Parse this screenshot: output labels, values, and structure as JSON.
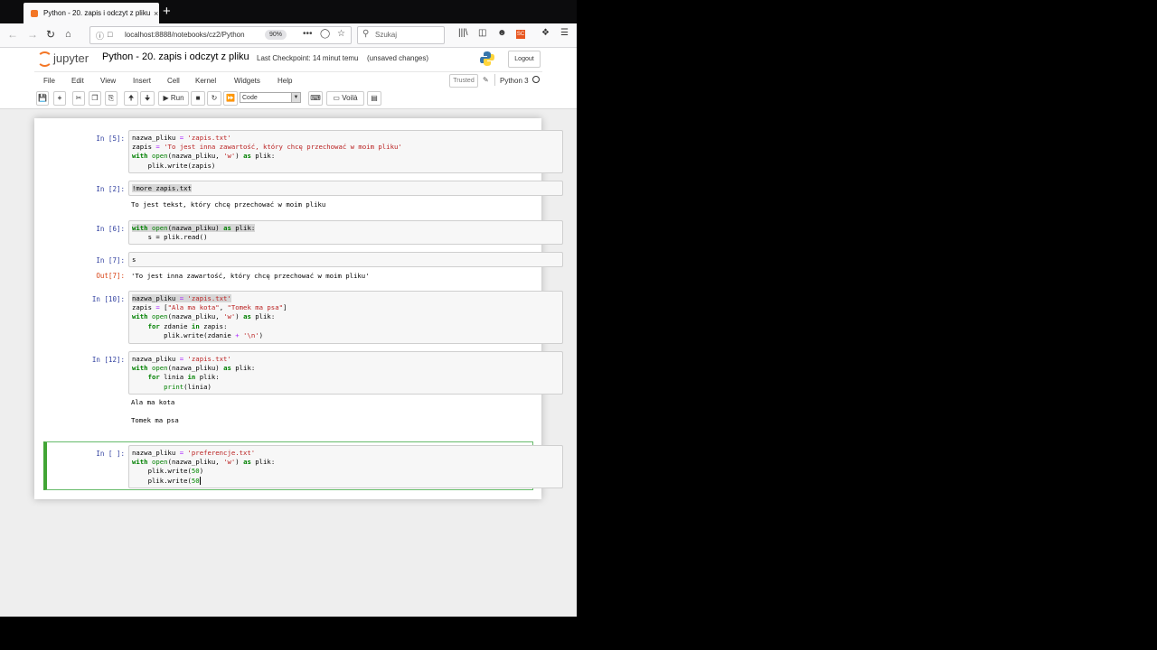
{
  "browser": {
    "tab_title": "Python - 20. zapis i odczyt z pliku",
    "tab_close": "×",
    "new_tab": "+",
    "url": "localhost:8888/notebooks/cz2/Python",
    "zoom": "90%",
    "search_placeholder": "Szukaj",
    "page_actions": "•••"
  },
  "jupyter": {
    "logo_text": "jupyter",
    "notebook_title": "Python - 20. zapis i odczyt z pliku",
    "checkpoint": "Last Checkpoint: 14 minut temu",
    "unsaved": "(unsaved changes)",
    "logout": "Logout",
    "menu": [
      "File",
      "Edit",
      "View",
      "Insert",
      "Cell",
      "Kernel",
      "Widgets",
      "Help"
    ],
    "trusted": "Trusted",
    "kernel_name": "Python 3",
    "toolbar": {
      "run": "Run",
      "cell_type": "Code",
      "voila": "Voilà"
    }
  },
  "cells": {
    "c1": {
      "prompt": "In [5]:"
    },
    "c2": {
      "prompt": "In [2]:",
      "output": "To jest tekst, który chcę przechować w moim pliku"
    },
    "c3": {
      "prompt": "In [6]:"
    },
    "c4": {
      "prompt": "In [7]:",
      "out_prompt": "Out[7]:",
      "output": "'To jest inna zawartość, który chcę przechować w moim pliku'"
    },
    "c5": {
      "prompt": "In [10]:"
    },
    "c6": {
      "prompt": "In [12]:",
      "output1": "Ala ma kota",
      "output2": "Tomek ma psa"
    },
    "c7": {
      "prompt": "In [ ]:"
    }
  },
  "code": {
    "c1_l1_a": "nazwa_pliku ",
    "c1_l1_b": "=",
    "c1_l1_c": " 'zapis.txt'",
    "c1_l2_a": "zapis ",
    "c1_l2_b": "=",
    "c1_l2_c": " 'To jest inna zawartość, który chcę przechować w moim pliku'",
    "c1_l3_kw": "with",
    "c1_l3_fn": "open",
    "c1_l3_a": "(nazwa_pliku, ",
    "c1_l3_s": "'w'",
    "c1_l3_b": ") ",
    "c1_l3_as": "as",
    "c1_l3_c": " plik:",
    "c1_l4": "    plik.write(zapis)",
    "c2_l1": "!more zapis.txt",
    "c3_l1_kw": "with",
    "c3_l1_fn": "open",
    "c3_l1_a": "(nazwa_pliku) ",
    "c3_l1_as": "as",
    "c3_l1_b": " plik:",
    "c3_l2": "    s = plik.read()",
    "c4_l1": "s",
    "c5_l1_a": "nazwa_pliku ",
    "c5_l1_b": "=",
    "c5_l1_c": " 'zapis.txt'",
    "c5_l2_a": "zapis ",
    "c5_l2_b": "=",
    "c5_l2_c": " [",
    "c5_l2_s1": "\"Ala ma kota\"",
    "c5_l2_d": ", ",
    "c5_l2_s2": "\"Tomek ma psa\"",
    "c5_l2_e": "]",
    "c5_l3_kw": "with",
    "c5_l3_fn": "open",
    "c5_l3_a": "(nazwa_pliku, ",
    "c5_l3_s": "'w'",
    "c5_l3_b": ") ",
    "c5_l3_as": "as",
    "c5_l3_c": " plik:",
    "c5_l4_ind": "    ",
    "c5_l4_kw": "for",
    "c5_l4_a": " zdanie ",
    "c5_l4_in": "in",
    "c5_l4_b": " zapis:",
    "c5_l5_a": "        plik.write(zdanie ",
    "c5_l5_op": "+",
    "c5_l5_s": " '\\n'",
    "c5_l5_b": ")",
    "c6_l1_a": "nazwa_pliku ",
    "c6_l1_b": "=",
    "c6_l1_c": " 'zapis.txt'",
    "c6_l2_kw": "with",
    "c6_l2_fn": "open",
    "c6_l2_a": "(nazwa_pliku) ",
    "c6_l2_as": "as",
    "c6_l2_b": " plik:",
    "c6_l3_ind": "    ",
    "c6_l3_kw": "for",
    "c6_l3_a": " linia ",
    "c6_l3_in": "in",
    "c6_l3_b": " plik:",
    "c6_l4_ind": "        ",
    "c6_l4_fn": "print",
    "c6_l4_a": "(linia)",
    "c7_l1_a": "nazwa_pliku ",
    "c7_l1_b": "=",
    "c7_l1_c": " 'preferencje.txt'",
    "c7_l2_kw": "with",
    "c7_l2_fn": "open",
    "c7_l2_a": "(nazwa_pliku, ",
    "c7_l2_s": "'w'",
    "c7_l2_b": ") ",
    "c7_l2_as": "as",
    "c7_l2_c": " plik:",
    "c7_l3_a": "    plik.write(",
    "c7_l3_n": "50",
    "c7_l3_b": ")",
    "c7_l4_a": "    plik.write(",
    "c7_l4_n": "50"
  }
}
